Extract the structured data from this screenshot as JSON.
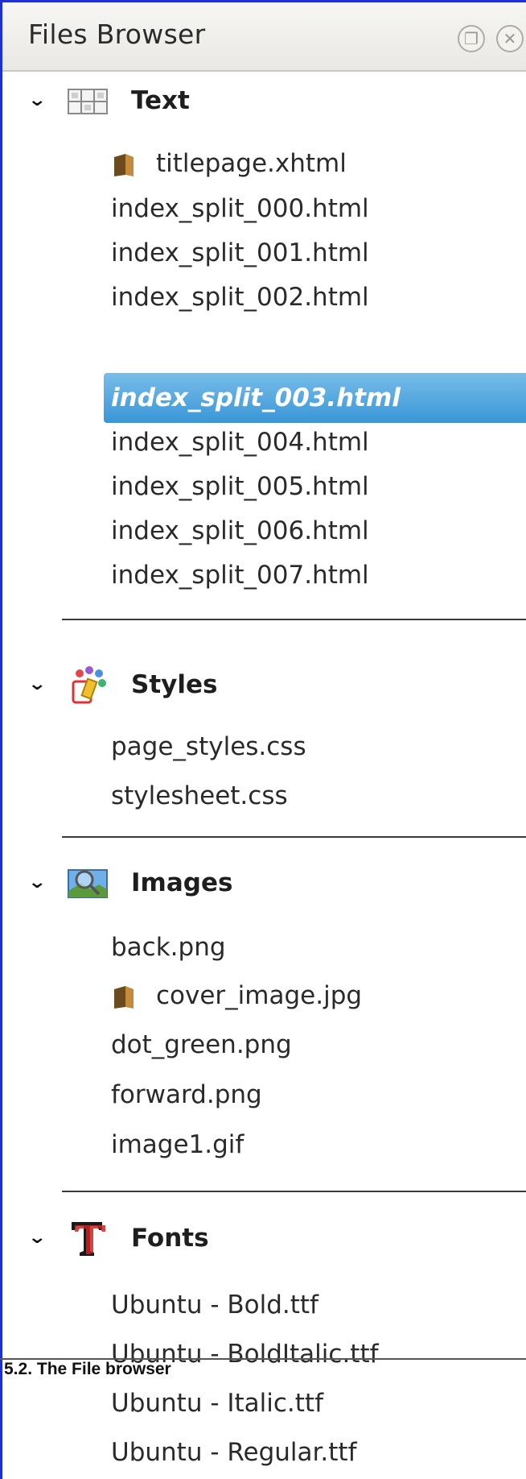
{
  "panel": {
    "title": "Files Browser",
    "float_icon": "restore-window-icon",
    "close_icon": "close-icon"
  },
  "categories": {
    "text": {
      "label": "Text",
      "icon": "text-grid-icon",
      "files": [
        "titlepage.xhtml",
        "index_split_000.html",
        "index_split_001.html",
        "index_split_002.html",
        "index_split_003.html",
        "index_split_004.html",
        "index_split_005.html",
        "index_split_006.html",
        "index_split_007.html"
      ],
      "selected": "index_split_003.html"
    },
    "styles": {
      "label": "Styles",
      "icon": "styles-palette-icon",
      "files": [
        "page_styles.css",
        "stylesheet.css"
      ]
    },
    "images": {
      "label": "Images",
      "icon": "image-magnifier-icon",
      "files": [
        "back.png",
        "cover_image.jpg",
        "dot_green.png",
        "forward.png",
        "image1.gif"
      ]
    },
    "fonts": {
      "label": "Fonts",
      "icon": "font-t-icon",
      "files": [
        "Ubuntu - Bold.ttf",
        "Ubuntu - BoldItalic.ttf",
        "Ubuntu - Italic.ttf",
        "Ubuntu - Regular.ttf"
      ]
    }
  },
  "caption": "5.2. The File browser",
  "colors": {
    "selection": "#3a96d6",
    "border": "#1f2fd6"
  }
}
